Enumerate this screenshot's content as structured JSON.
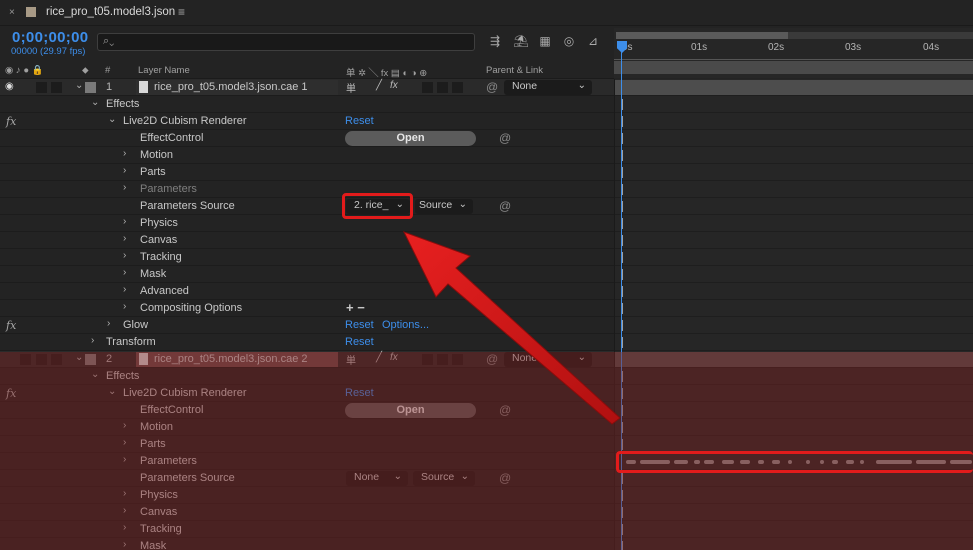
{
  "tab": {
    "close": "×",
    "title": "rice_pro_t05.model3.json",
    "menu": "≡"
  },
  "time": {
    "timecode": "0;00;00;00",
    "fps": "00000 (29.97 fps)"
  },
  "search": {
    "placeholder": "",
    "icon": "search-icon"
  },
  "ruler": {
    "ticks": [
      "0s",
      "01s",
      "02s",
      "03s",
      "04s"
    ]
  },
  "columns": {
    "num": "#",
    "layer_name": "Layer Name",
    "switches": "单 ✲ ╲ fx ▤ ◐ ◑ ⊕",
    "parent": "Parent & Link"
  },
  "rows": {
    "layer1_num": "1",
    "layer1_name": "rice_pro_t05.model3.json.cae 1",
    "layer1_parent": "None",
    "effects": "Effects",
    "renderer": "Live2D Cubism Renderer",
    "reset": "Reset",
    "effect_control": "EffectControl",
    "open": "Open",
    "motion": "Motion",
    "parts": "Parts",
    "parameters": "Parameters",
    "parameters_source": "Parameters Source",
    "param_source_value": "2. rice_",
    "source": "Source",
    "physics": "Physics",
    "canvas": "Canvas",
    "tracking": "Tracking",
    "mask": "Mask",
    "advanced": "Advanced",
    "compositing": "Compositing Options",
    "plusminus": "+ −",
    "glow": "Glow",
    "options": "Options...",
    "transform": "Transform",
    "layer2_num": "2",
    "layer2_name": "rice_pro_t05.model3.json.cae 2",
    "layer2_parent": "None",
    "none": "None",
    "fx": "fx"
  },
  "colors": {
    "accent": "#3d8eea",
    "highlight": "#e21b1b",
    "selected_layer": "#802222"
  }
}
